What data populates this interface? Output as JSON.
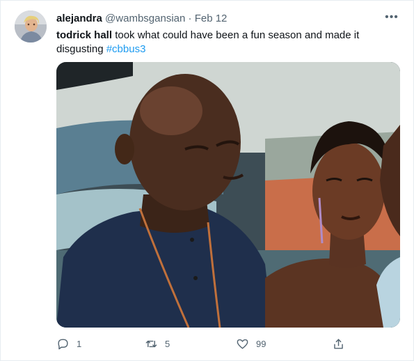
{
  "tweet": {
    "author": {
      "display_name": "alejandra",
      "handle": "@wambsgansian",
      "separator": "·",
      "date": "Feb 12"
    },
    "more_icon": "more-horizontal-icon",
    "text": {
      "mention_bold": "todrick hall",
      "body": " took what could have been a fun season and made it disgusting ",
      "hashtag": "#cbbus3"
    },
    "actions": {
      "reply": {
        "icon": "reply-icon",
        "count": "1"
      },
      "retweet": {
        "icon": "retweet-icon",
        "count": "5"
      },
      "like": {
        "icon": "heart-icon",
        "count": "99"
      },
      "share": {
        "icon": "share-icon"
      }
    },
    "colors": {
      "accent": "#1d9bf0",
      "text": "#0f1419",
      "secondary": "#536471"
    }
  }
}
